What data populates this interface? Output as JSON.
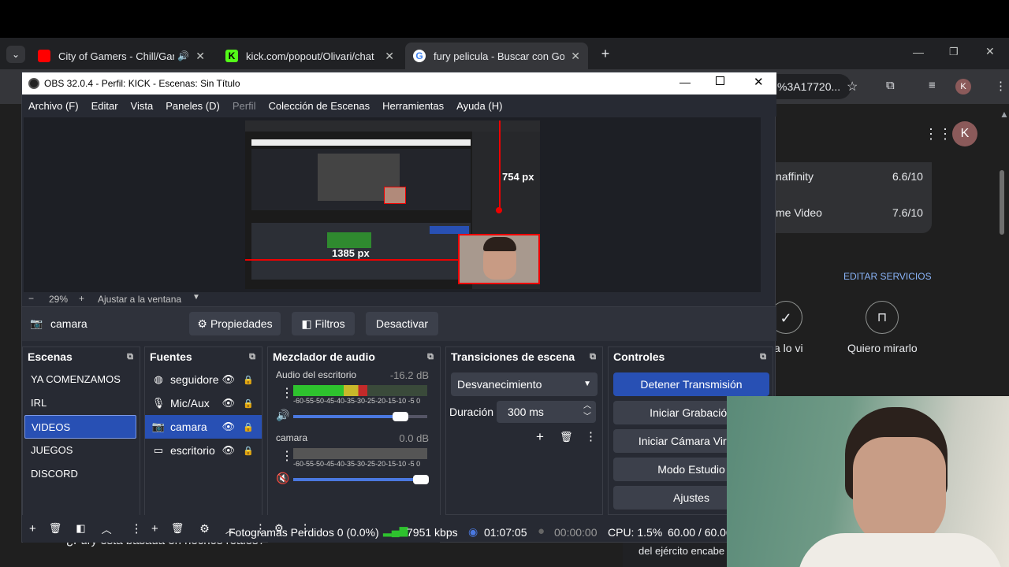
{
  "browser": {
    "tabs": [
      {
        "title": "City of Gamers - Chill/Gami",
        "color": "#ff0000"
      },
      {
        "title": "kick.com/popout/Olivari/chat",
        "color": "#53fc18"
      },
      {
        "title": "fury pelicula - Buscar con Goog",
        "color": "#4285f4"
      }
    ],
    "new_tab": "+",
    "url_fragment": "%3A17720...",
    "profile_initial": "K",
    "ratings": [
      {
        "name": "naffinity",
        "value": "6.6/10"
      },
      {
        "name": "me Video",
        "value": "7.6/10"
      }
    ],
    "edit_services": "EDITAR SERVICIOS",
    "seen_label": "a lo vi",
    "want_label": "Quiero mirarlo",
    "bottom_text": "¿Fury está basada en hechos reales?",
    "side_text": "del ejército encabe"
  },
  "obs": {
    "title": "OBS 32.0.4 - Perfil: KICK - Escenas: Sin Título",
    "menu": [
      "Archivo (F)",
      "Editar",
      "Vista",
      "Paneles (D)",
      "Perfil",
      "Colección de Escenas",
      "Herramientas",
      "Ayuda (H)"
    ],
    "preview": {
      "width_label": "754 px",
      "height_label": "1385 px"
    },
    "zoom": {
      "minus": "−",
      "value": "29%",
      "plus": "+",
      "fit": "Ajustar a la ventana"
    },
    "source_bar": {
      "name": "camara",
      "properties": "Propiedades",
      "filters": "Filtros",
      "deactivate": "Desactivar"
    },
    "scenes": {
      "title": "Escenas",
      "items": [
        "YA COMENZAMOS",
        "IRL",
        "VIDEOS",
        "JUEGOS",
        "DISCORD"
      ],
      "selected": 2
    },
    "sources": {
      "title": "Fuentes",
      "items": [
        {
          "name": "seguidore",
          "icon": "globe-icon"
        },
        {
          "name": "Mic/Aux",
          "icon": "microphone-icon"
        },
        {
          "name": "camara",
          "icon": "camera-icon"
        },
        {
          "name": "escritorio",
          "icon": "monitor-icon"
        }
      ],
      "selected": 2
    },
    "mixer": {
      "title": "Mezclador de audio",
      "channels": [
        {
          "name": "Audio del escritorio",
          "db": "-16.2 dB",
          "level": 0.55,
          "volume": 0.8
        },
        {
          "name": "camara",
          "db": "0.0 dB",
          "level": 0.0,
          "volume": 1.0
        }
      ],
      "scale": "-60-55-50-45-40-35-30-25-20-15-10 -5 0"
    },
    "transitions": {
      "title": "Transiciones de escena",
      "selected": "Desvanecimiento",
      "duration_label": "Duración",
      "duration": "300 ms"
    },
    "controls": {
      "title": "Controles",
      "buttons": [
        "Detener Transmisión",
        "Iniciar Grabación",
        "Iniciar Cámara Virtual",
        "Modo Estudio",
        "Ajustes"
      ]
    },
    "status": {
      "dropped": "Fotogramas Perdidos 0 (0.0%)",
      "bitrate": "7951 kbps",
      "stream_time": "01:07:05",
      "rec_time": "00:00:00",
      "cpu": "CPU: 1.5%",
      "fps": "60.00 / 60.00"
    }
  }
}
